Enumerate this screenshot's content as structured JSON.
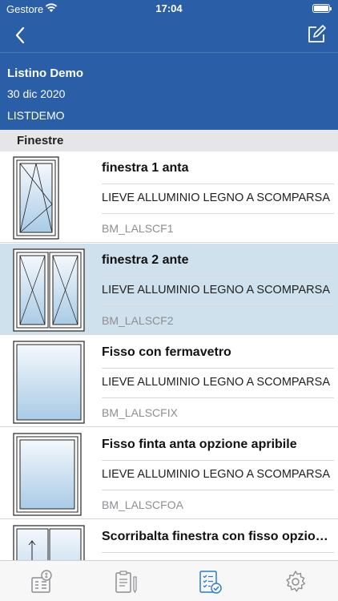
{
  "statusbar": {
    "carrier": "Gestore",
    "time": "17:04"
  },
  "navbar": {
    "back_icon": "chevron-left-icon",
    "edit_icon": "compose-icon"
  },
  "header": {
    "title": "Listino Demo",
    "date": "30 dic 2020",
    "code": "LISTDEMO"
  },
  "section": {
    "title": "Finestre"
  },
  "items": [
    {
      "name": "finestra 1 anta",
      "description": "LIEVE ALLUMINIO LEGNO A SCOMPARSA",
      "code": "BM_LALSCF1",
      "selected": false
    },
    {
      "name": "finestra 2 ante",
      "description": "LIEVE ALLUMINIO LEGNO A SCOMPARSA",
      "code": "BM_LALSCF2",
      "selected": true
    },
    {
      "name": "Fisso con fermavetro",
      "description": "LIEVE ALLUMINIO LEGNO A SCOMPARSA",
      "code": "BM_LALSCFIX",
      "selected": false
    },
    {
      "name": "Fisso finta anta opzione apribile",
      "description": "LIEVE ALLUMINIO LEGNO A SCOMPARSA",
      "code": "BM_LALSCFOA",
      "selected": false
    },
    {
      "name": "Scorribalta finestra con fisso opzionale",
      "description": "",
      "code": "",
      "selected": false
    }
  ],
  "tabbar": {
    "tabs": [
      {
        "icon": "price-list-calculator-icon",
        "active": false
      },
      {
        "icon": "clipboard-pencil-icon",
        "active": false
      },
      {
        "icon": "checklist-icon",
        "active": true
      },
      {
        "icon": "gear-icon",
        "active": false
      }
    ],
    "active_color": "#2a7bd0",
    "inactive_color": "#8e8e93"
  },
  "colors": {
    "header": "#2a5ea6",
    "selected_row": "#cfe1ed"
  }
}
